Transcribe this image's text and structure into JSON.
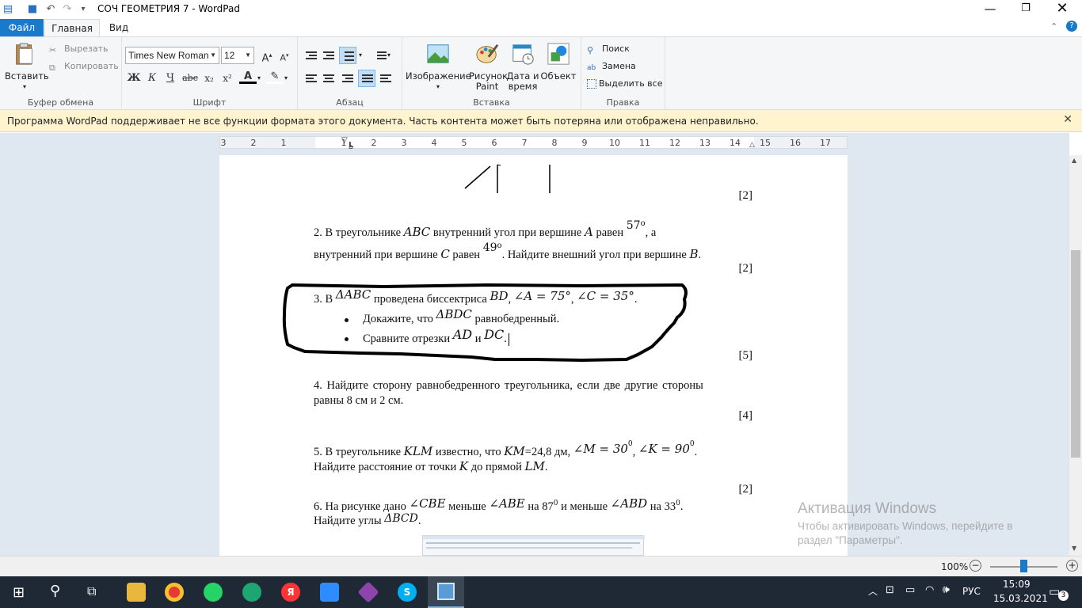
{
  "window": {
    "title": "СОЧ ГЕОМЕТРИЯ 7 - WordPad"
  },
  "tabs": {
    "file": "Файл",
    "home": "Главная",
    "view": "Вид"
  },
  "ribbon": {
    "clipboard": {
      "paste": "Вставить",
      "cut": "Вырезать",
      "copy": "Копировать",
      "label": "Буфер обмена"
    },
    "font": {
      "family": "Times New Roman",
      "size": "12",
      "label": "Шрифт",
      "bold": "Ж",
      "italic": "К",
      "underline": "Ч",
      "strike": "abc",
      "sub": "x₂",
      "sup": "x²",
      "color": "A"
    },
    "paragraph": {
      "label": "Абзац"
    },
    "insert": {
      "image": "Изображение",
      "paint1": "Рисунок",
      "paint2": "Paint",
      "date1": "Дата и",
      "date2": "время",
      "object": "Объект",
      "label": "Вставка"
    },
    "editing": {
      "find": "Поиск",
      "replace": "Замена",
      "select_all": "Выделить все",
      "label": "Правка"
    }
  },
  "message_bar": {
    "text": "Программа WordPad поддерживает не все функции формата этого документа. Часть контента может быть потеряна или отображена неправильно."
  },
  "ruler": {
    "numbers": [
      "3",
      "2",
      "1",
      "1",
      "2",
      "3",
      "4",
      "5",
      "6",
      "7",
      "8",
      "9",
      "10",
      "11",
      "12",
      "13",
      "14",
      "15",
      "16",
      "17"
    ]
  },
  "document": {
    "q1_score": "[2]",
    "q2": {
      "a": "2. В треугольнике ",
      "abc": "ABC",
      "b": " внутренний угол при вершине ",
      "A": "A",
      "c": " равен ",
      "v1": "57",
      "deg": "o",
      "d": ", а",
      "e": "внутренний при вершине ",
      "C": "C",
      "f": " равен ",
      "v2": "49",
      "g": ". Найдите внешний угол при вершине ",
      "B": "B",
      "h": ".",
      "score": "[2]"
    },
    "q3": {
      "a": "3. В ",
      "tri": "ΔABC",
      "b": " проведена биссектриса ",
      "bd": "BD",
      "c": ", ",
      "angA": "∠A = 75°",
      "d": ", ",
      "angC": "∠C = 35°",
      "e": ".",
      "b1a": "Докажите, что ",
      "b1t": "ΔBDC",
      "b1b": " равнобедренный.",
      "b2a": "Сравните отрезки ",
      "ad": "AD",
      "and": " и ",
      "dc": "DC",
      "b2b": ".",
      "score": "[5]"
    },
    "q4": {
      "l1": "4.  Найдите  сторону  равнобедренного  треугольника,  если  две  другие  стороны",
      "l2": "равны 8 см и 2 см.",
      "score": "[4]"
    },
    "q5": {
      "a": "5. В треугольнике ",
      "klm": "KLM",
      "b": " известно, что ",
      "km": "KM",
      "c": "=24,8 дм, ",
      "angM": "∠M = 30",
      "deg": "0",
      "d": ", ",
      "angK": "∠K = 90",
      "e": ".",
      "l2a": "Найдите расстояние от точки ",
      "K": "K",
      "l2b": " до прямой ",
      "LM": "LM",
      "l2c": ".",
      "score": "[2]"
    },
    "q6": {
      "a": "6. На рисунке дано ",
      "cbe": "∠CBE",
      "b": " меньше ",
      "abe": "∠ABE",
      "c": " на 87",
      "deg": "0",
      "d": " и меньше ",
      "abd": "∠ABD",
      "e": " на 33",
      "f": ".",
      "l2a": "Найдите углы ",
      "bcd": "ΔBCD",
      "l2b": "."
    }
  },
  "watermark": {
    "title": "Активация Windows",
    "line1": "Чтобы активировать Windows, перейдите в",
    "line2": "раздел \"Параметры\"."
  },
  "status": {
    "zoom": "100%"
  },
  "taskbar": {
    "lang": "РУС",
    "time": "15:09",
    "date": "15.03.2021",
    "notif": "3"
  },
  "colors": {
    "accent": "#1979ca",
    "msgbar": "#fff4ce",
    "taskbar": "#1f2936",
    "page_bg": "#dfe7f0"
  }
}
